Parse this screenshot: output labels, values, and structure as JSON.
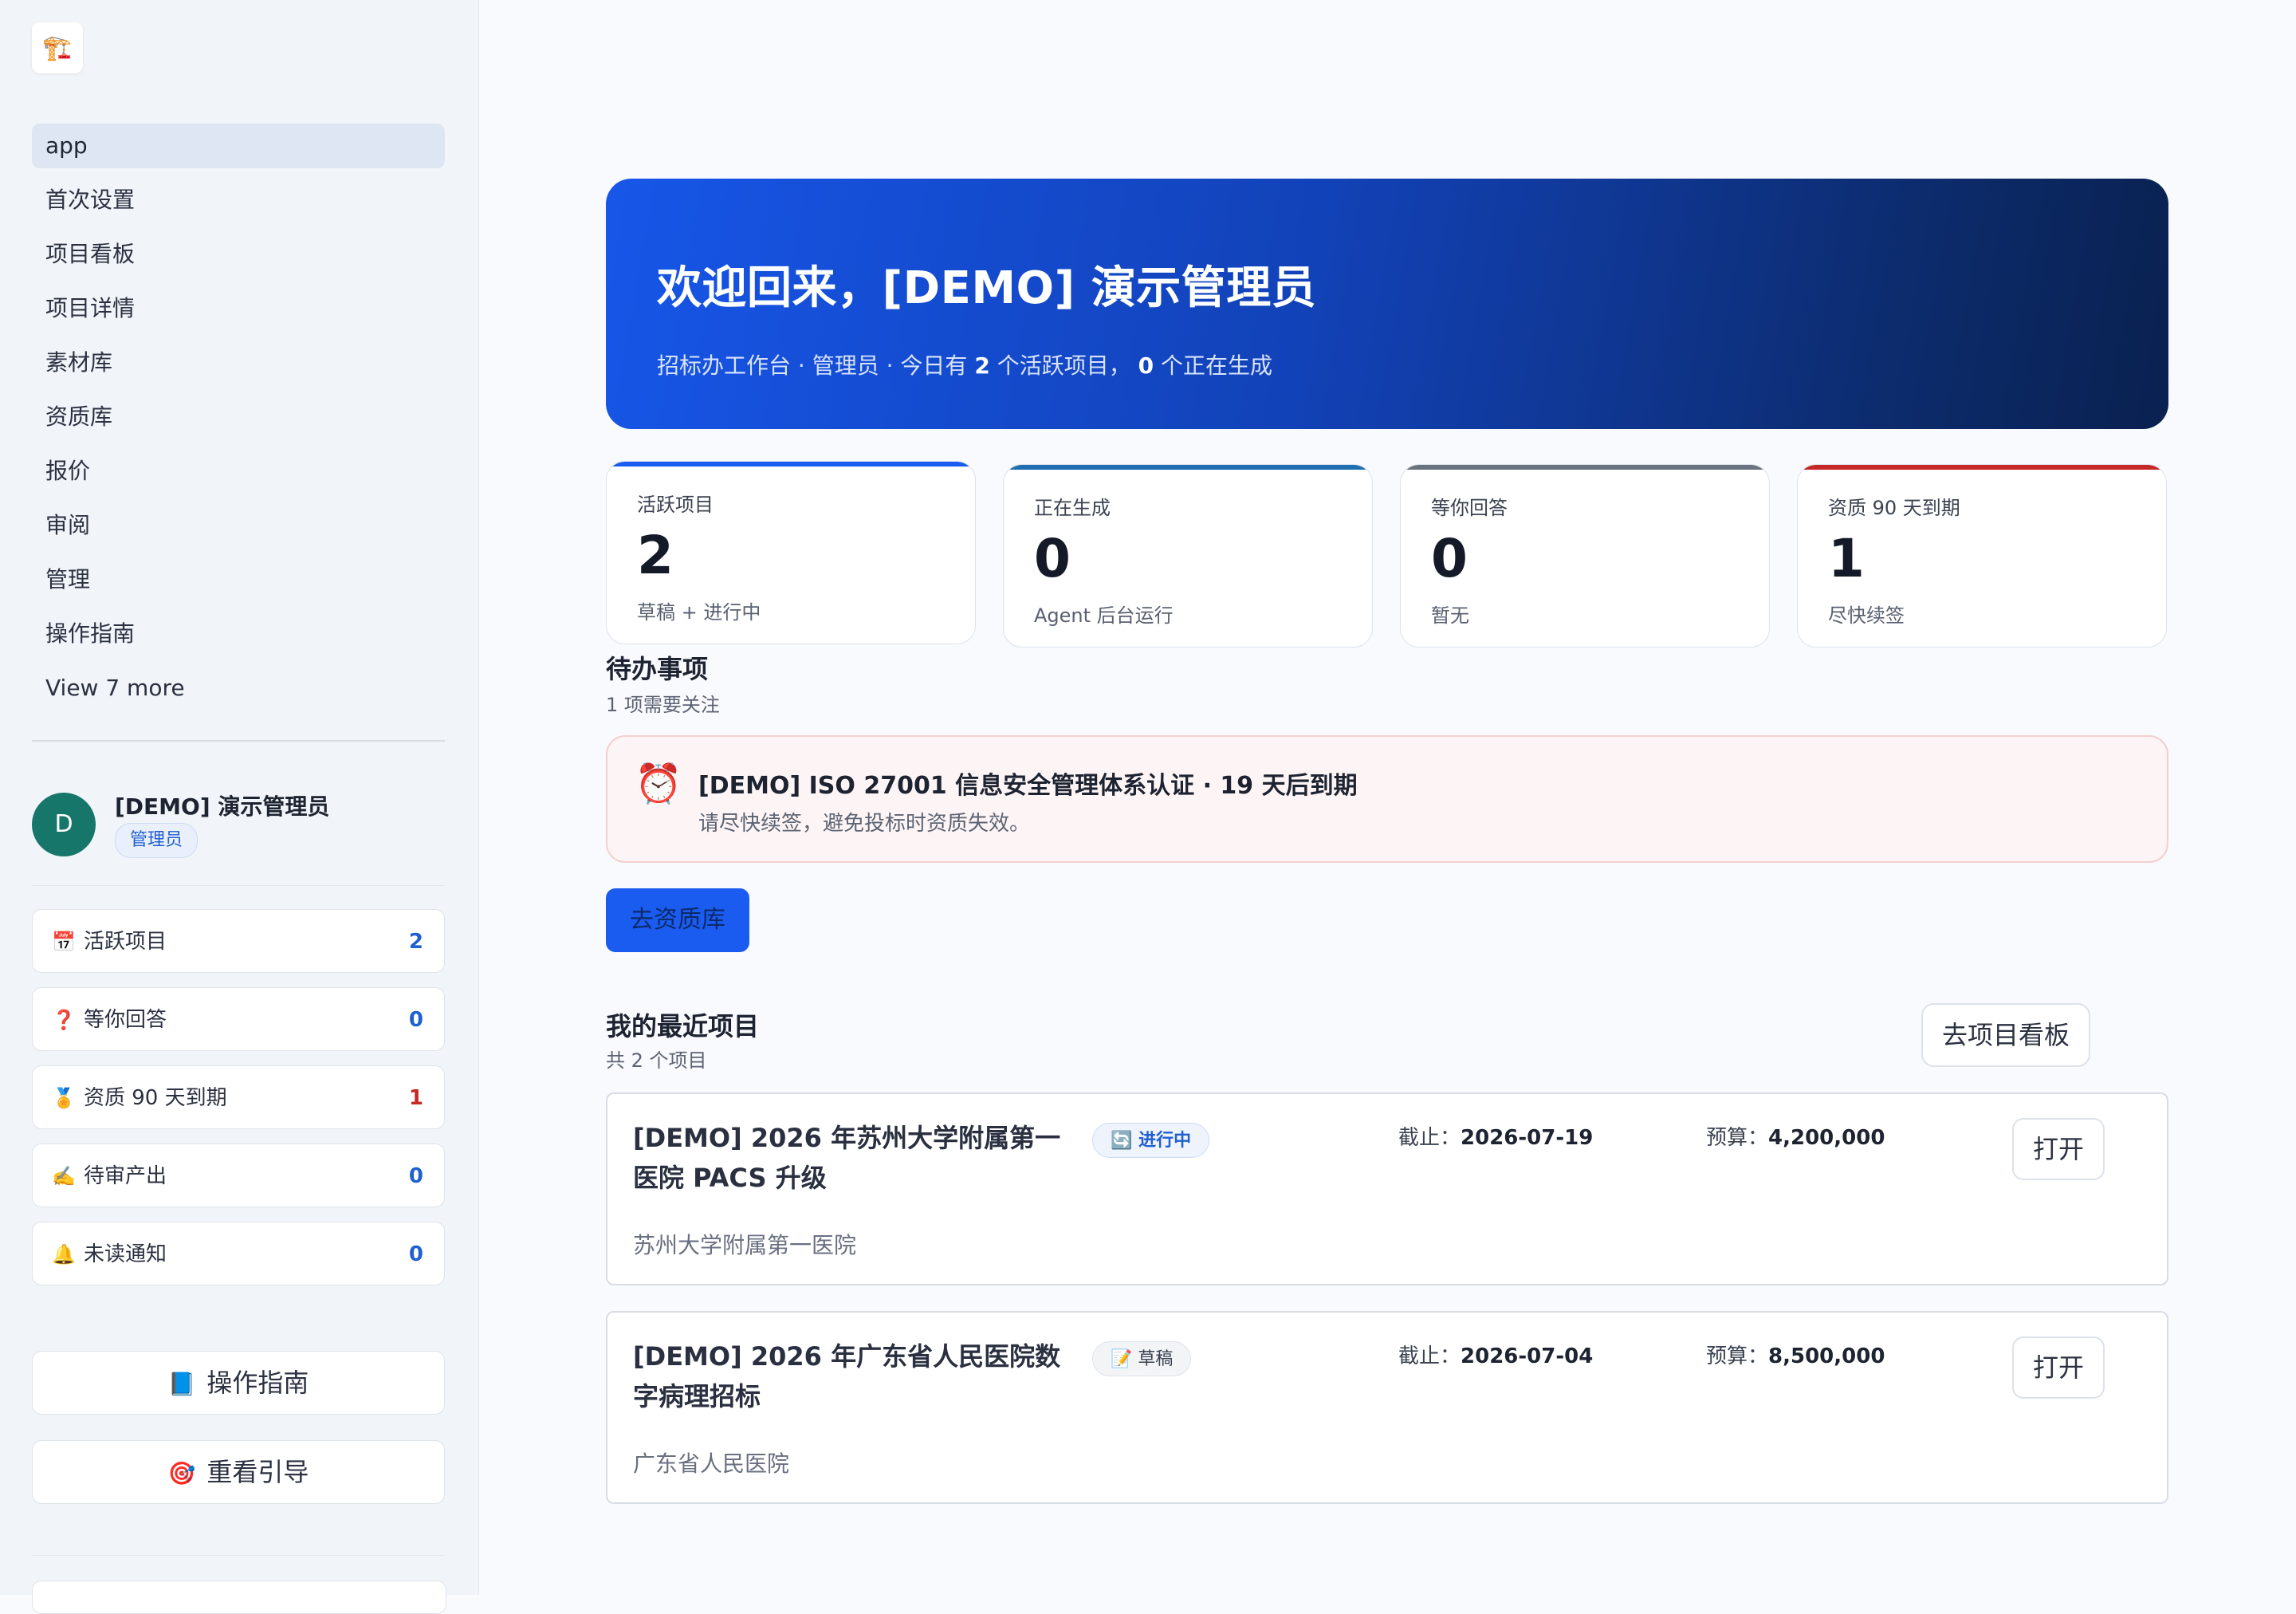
{
  "sidebar": {
    "logo_icon": "app-logo-icon",
    "nav": [
      {
        "label": "app",
        "active": true
      },
      {
        "label": "首次设置"
      },
      {
        "label": "项目看板"
      },
      {
        "label": "项目详情"
      },
      {
        "label": "素材库"
      },
      {
        "label": "资质库"
      },
      {
        "label": "报价"
      },
      {
        "label": "审阅"
      },
      {
        "label": "管理"
      },
      {
        "label": "操作指南"
      }
    ],
    "more": "View 7 more",
    "user": {
      "initial": "D",
      "name": "[DEMO] 演示管理员",
      "role": "管理员",
      "avatar_color": "#17766a"
    },
    "stats": [
      {
        "icon": "📅",
        "label": "活跃项目",
        "count": "2"
      },
      {
        "icon": "❓",
        "label": "等你回答",
        "count": "0"
      },
      {
        "icon": "🏅",
        "label": "资质 90 天到期",
        "count": "1"
      },
      {
        "icon": "✍️",
        "label": "待审产出",
        "count": "0"
      },
      {
        "icon": "🔔",
        "label": "未读通知",
        "count": "0"
      }
    ],
    "guide_button": {
      "icon": "📘",
      "label": "操作指南"
    },
    "tour_button": {
      "icon": "🎯",
      "label": "重看引导"
    }
  },
  "hero": {
    "title": "欢迎回来，[DEMO] 演示管理员",
    "sub_prefix": "招标办工作台 · 管理员 · 今日有 ",
    "active_count": "2",
    "sub_mid": " 个活跃项目， ",
    "generating_count": "0",
    "sub_suffix": " 个正在生成"
  },
  "cards": [
    {
      "label": "活跃项目",
      "value": "2",
      "note": "草稿 + 进行中",
      "color": "#1a5cf0"
    },
    {
      "label": "正在生成",
      "value": "0",
      "note": "Agent 后台运行",
      "color": "#1f6fb2"
    },
    {
      "label": "等你回答",
      "value": "0",
      "note": "暂无",
      "color": "#6b7280"
    },
    {
      "label": "资质 90 天到期",
      "value": "1",
      "note": "尽快续签",
      "color": "#c62828"
    }
  ],
  "todo": {
    "title": "待办事项",
    "subtitle": "1 项需要关注",
    "alert": {
      "icon": "alarm-clock-icon",
      "title": "[DEMO] ISO 27001 信息安全管理体系认证 · 19 天后到期",
      "desc": "请尽快续签，避免投标时资质失效。"
    },
    "action": "去资质库"
  },
  "recent": {
    "title": "我的最近项目",
    "subtitle": "共 2 个项目",
    "board_button": "去项目看板",
    "deadline_label": "截止：",
    "budget_label": "预算：",
    "open_label": "打开",
    "projects": [
      {
        "name": "[DEMO] 2026 年苏州大学附属第一医院 PACS 升级",
        "status_icon": "🔄",
        "status": "进行中",
        "deadline": "2026-07-19",
        "budget": "4,200,000",
        "org": "苏州大学附属第一医院"
      },
      {
        "name": "[DEMO] 2026 年广东省人民医院数字病理招标",
        "status_icon": "📝",
        "status": "草稿",
        "deadline": "2026-07-04",
        "budget": "8,500,000",
        "org": "广东省人民医院"
      }
    ]
  }
}
